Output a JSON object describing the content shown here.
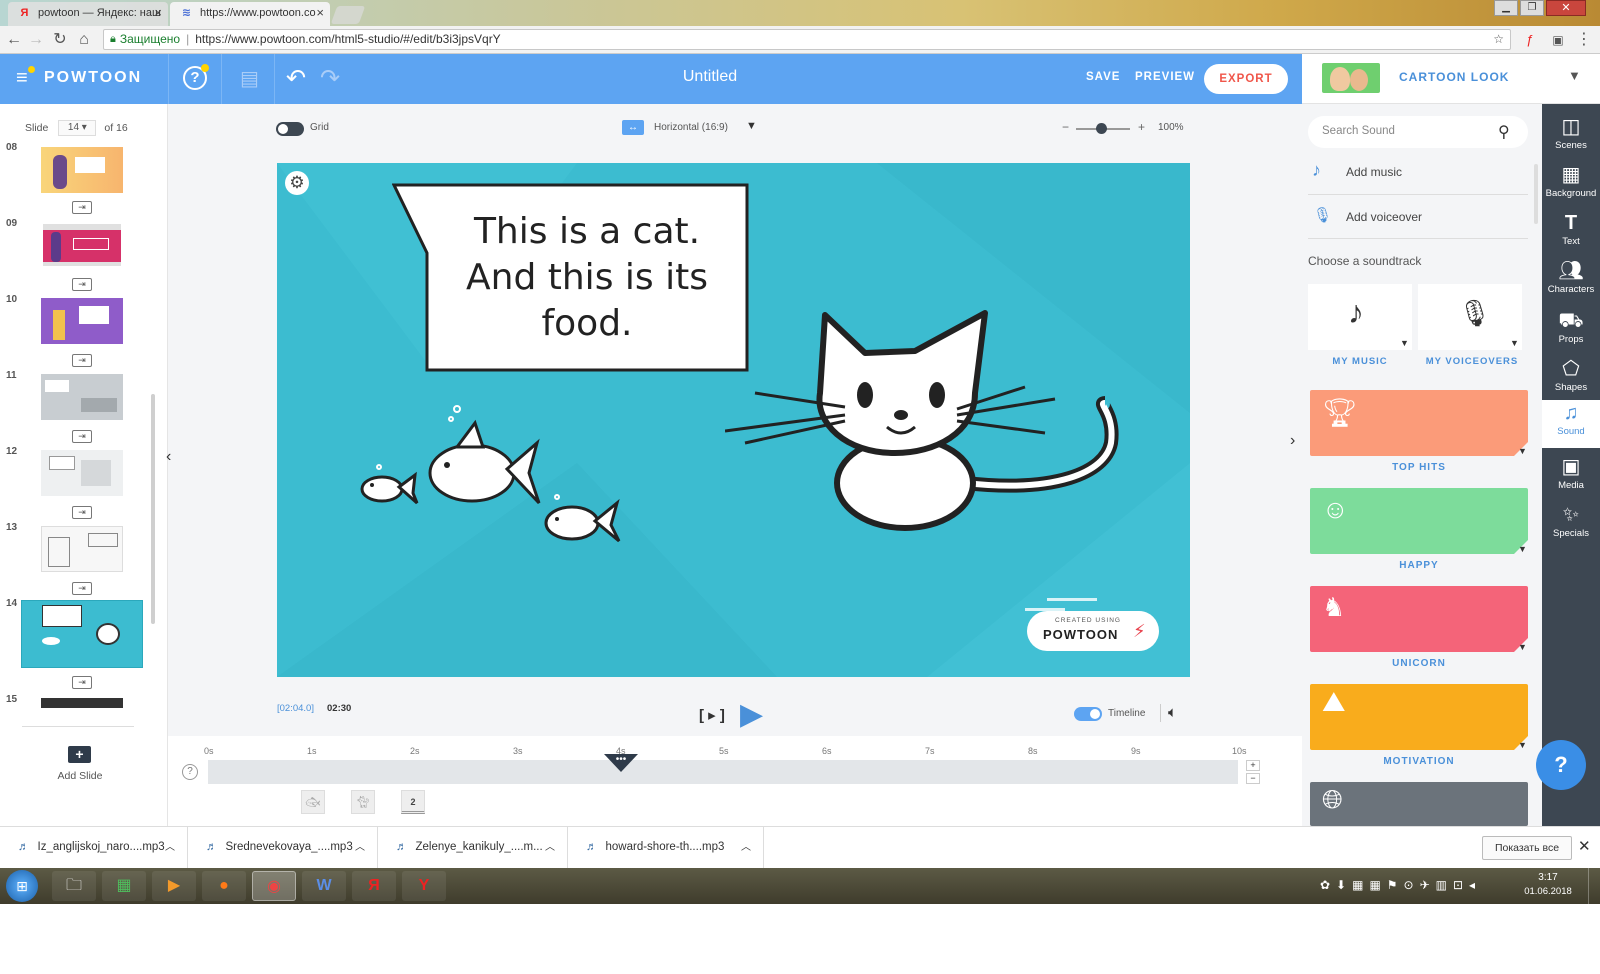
{
  "browser": {
    "tabs": [
      {
        "title": "powtoon — Яндекс: наш",
        "icon": "yandex-icon"
      },
      {
        "title": "https://www.powtoon.co",
        "icon": "powtoon-icon"
      }
    ],
    "secure_label": "Защищено",
    "url": "https://www.powtoon.com/html5-studio/#/edit/b3i3jpsVqrY"
  },
  "header": {
    "logo": "POWTOON",
    "title": "Untitled",
    "save": "SAVE",
    "preview": "PREVIEW",
    "export": "EXPORT",
    "style_name": "CARTOON LOOK"
  },
  "slides": {
    "label": "Slide",
    "current": "14",
    "of": "of 16",
    "numbers": [
      "08",
      "09",
      "10",
      "11",
      "12",
      "13",
      "14",
      "15"
    ],
    "add_label": "Add Slide"
  },
  "toolbar": {
    "grid_label": "Grid",
    "orientation": "Horizontal (16:9)",
    "zoom": "100%"
  },
  "canvas": {
    "bubble_lines": [
      "This is a cat.",
      "And this is its",
      "food."
    ],
    "watermark_small": "CREATED USING",
    "watermark_big": "POWTOON"
  },
  "timeline": {
    "current": "[02:04.0]",
    "total": "02:30",
    "toggle_label": "Timeline",
    "ticks": [
      "0s",
      "1s",
      "2s",
      "3s",
      "4s",
      "5s",
      "6s",
      "7s",
      "8s",
      "9s",
      "10s"
    ],
    "layer_badge": "2"
  },
  "sound": {
    "search_placeholder": "Search Sound",
    "add_music": "Add music",
    "add_voiceover": "Add voiceover",
    "choose": "Choose a soundtrack",
    "my_music": "MY MUSIC",
    "my_voiceovers": "MY VOICEOVERS",
    "cards": [
      {
        "label": "TOP HITS",
        "color": "#fb9b79"
      },
      {
        "label": "HAPPY",
        "color": "#7ddc9b"
      },
      {
        "label": "UNICORN",
        "color": "#f46479"
      },
      {
        "label": "MOTIVATION",
        "color": "#f9ac1c"
      }
    ]
  },
  "rail": [
    "Scenes",
    "Background",
    "Text",
    "Characters",
    "Props",
    "Shapes",
    "Sound",
    "Media",
    "Specials"
  ],
  "downloads": {
    "files": [
      "Iz_anglijskoj_naro....mp3",
      "Srednevekovaya_....mp3",
      "Zelenye_kanikuly_....m...",
      "howard-shore-th....mp3"
    ],
    "show_all": "Показать все"
  },
  "taskbar": {
    "time": "3:17",
    "date": "01.06.2018"
  }
}
